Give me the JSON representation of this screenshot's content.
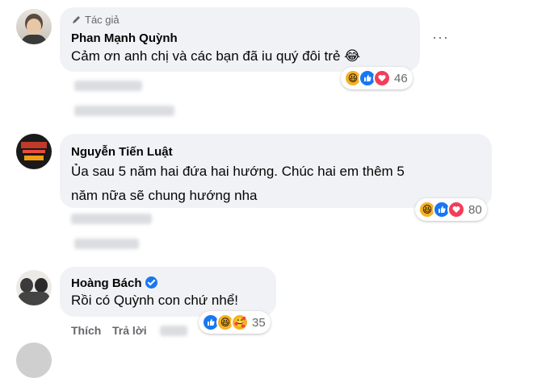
{
  "comments": [
    {
      "author_badge": "Tác giả",
      "name": "Phan Mạnh Quỳnh",
      "text": "Cảm ơn anh chị và các bạn đã iu quý đôi trẻ 😂",
      "reaction_count": "46",
      "more_icon": "more-dots-icon"
    },
    {
      "name": "Nguyễn Tiến Luật",
      "text_line1": "Ủa sau 5 năm hai đứa hai hướng. Chúc hai em thêm 5",
      "text_line2": "năm nữa sẽ chung hướng nha",
      "reaction_count": "80"
    },
    {
      "name": "Hoàng Bách",
      "text": "Rồi có Quỳnh con chứ nhể!",
      "reaction_count": "35",
      "actions": {
        "like": "Thích",
        "reply": "Trả lời"
      }
    }
  ],
  "colors": {
    "bubble": "#f0f2f5",
    "like_blue": "#1877f2",
    "love_red": "#f33e58",
    "haha_yellow": "#f7b125",
    "muted": "#65676b"
  }
}
